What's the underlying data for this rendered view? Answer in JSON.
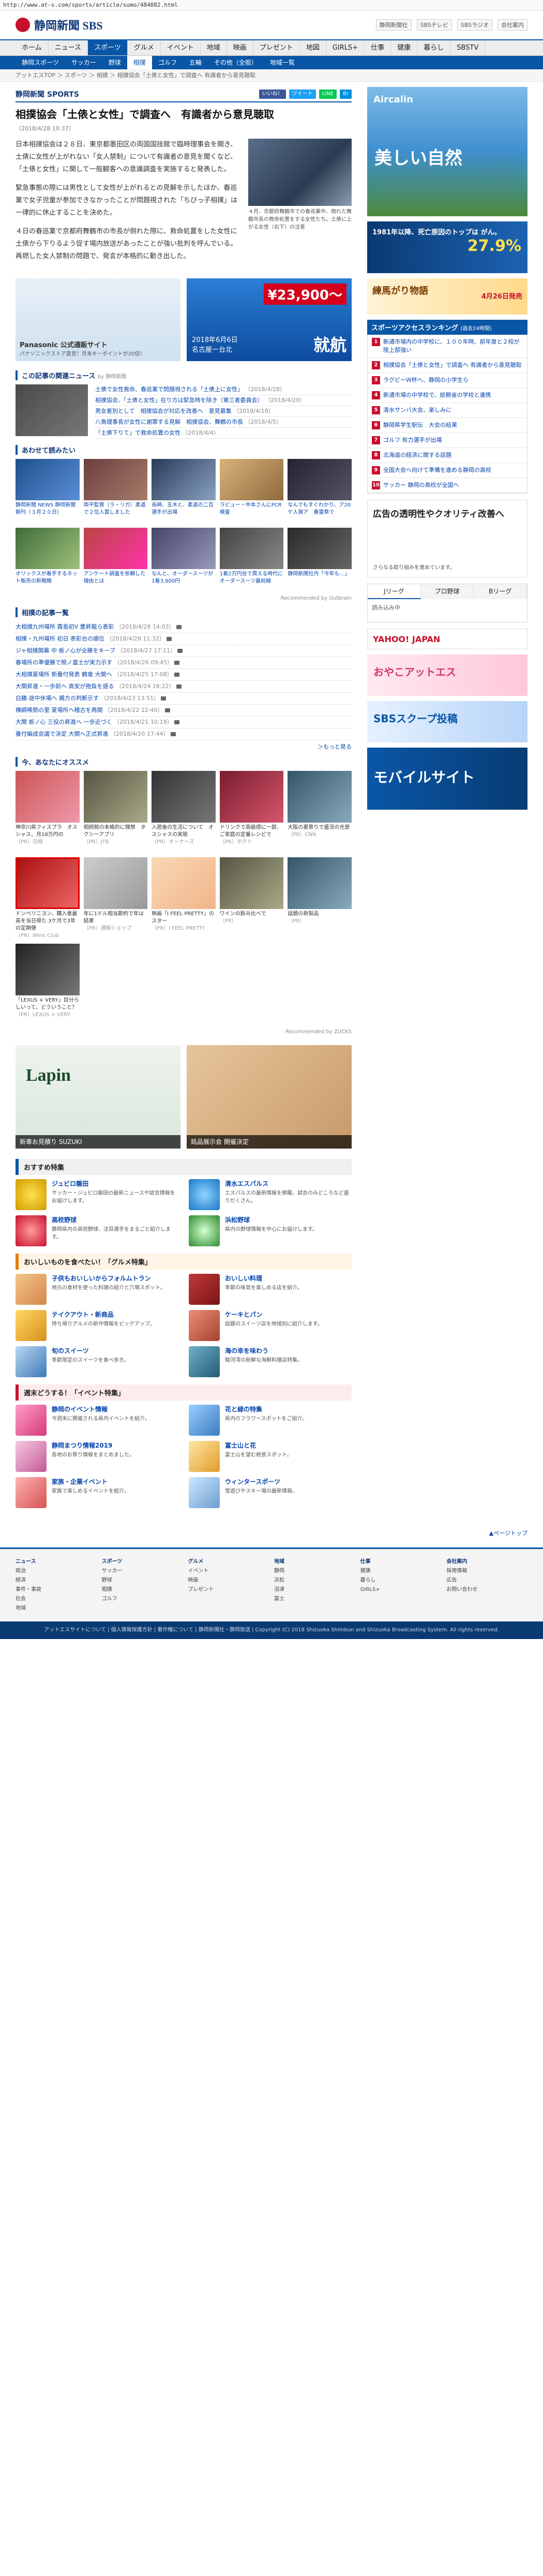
{
  "url": "http://www.at-s.com/sports/article/sumo/484082.html",
  "site": {
    "logo": "静岡新聞 SBS",
    "header_links": [
      "静岡新聞社",
      "SBSテレビ",
      "SBSラジオ",
      "会社案内"
    ]
  },
  "gnav": [
    "ホーム",
    "ニュース",
    "スポーツ",
    "グルメ",
    "イベント",
    "地域",
    "映画",
    "プレゼント",
    "地図",
    "GIRLS+",
    "仕事",
    "健康",
    "暮らし",
    "SBSTV",
    "SBSラジオ"
  ],
  "snav": [
    "静岡スポーツ",
    "サッカー",
    "野球",
    "相撲",
    "ゴルフ",
    "五輪",
    "その他（全般）",
    "静岡スポーツ",
    "地域一覧"
  ],
  "breadcrumb": "アットエスTOP ＞ スポーツ ＞ 相撲 ＞ 相撲協会「土俵と女性」で調査へ 有識者から意見聴取",
  "section": {
    "label": "静岡新聞 SPORTS"
  },
  "share": [
    "いいね！",
    "ツイート",
    "LINE",
    "B!"
  ],
  "article": {
    "title": "相撲協会「土俵と女性」で調査へ　有識者から意見聴取",
    "date": "（2018/4/28 10:37）",
    "paragraphs": [
      "日本相撲協会は２８日、東京都墨田区の両国国技館で臨時理事会を開き、土俵に女性が上がれない「女人禁制」について有識者の意見を聞くなど、「土俵と女性」に関して一般観客への意識調査を実施すると発表した。",
      "緊急事態の際には男性として女性が上がれるとの見解を示したほか、春巡業で女子児童が参加できなかったことが問題視された「ちびっ子相撲」は一律的に休止することを決めた。",
      "４日の春巡業で京都府舞鶴市の市長が倒れた際に、救命処置をした女性に土俵から下りるよう促す場内放送があったことが強い批判を呼んでいる。再燃した女人禁制の問題で、発言が本格的に動き出した。"
    ],
    "photo_caption": "４月、京都府舞鶴市での春巡業中、倒れた舞鶴市長の救命処置をする女性たち。土俵に上がる女性（右下）の注意"
  },
  "ads": {
    "left_label": "Panasonic 公式通販サイト",
    "left_sub": "パナソニックストア直営！月末キーポイントが20倍！",
    "right_price": "¥23,900〜",
    "right_date": "2018年6月6日",
    "right_big": "就航",
    "right_city": "名古屋ー台北"
  },
  "related": {
    "title": "この記事の関連ニュース",
    "sub": "by 静岡新聞",
    "items": [
      {
        "text": "土俵で女性救命、春巡業で問題視される「土俵上に女性」",
        "date": "（2018/4/28）"
      },
      {
        "text": "相撲協会、「土俵と女性」在り方は緊急時を除き（第三者委員会）",
        "date": "（2018/4/20）"
      },
      {
        "text": "男女差別として　相撲協会が対応を改善へ　意見募集",
        "date": "（2018/4/18）"
      },
      {
        "text": "八角理事長が女性に謝罪する見解　相撲協会、舞鶴の市長",
        "date": "（2018/4/5）"
      },
      {
        "text": "「土俵下りて」で救命処置の女性",
        "date": "（2018/4/4）"
      }
    ]
  },
  "pickup": {
    "title": "あわせて読みたい",
    "items": [
      "静岡新聞 NEWS 静岡新聞朝刊（３月２０日）",
      "両平監督（ラ・リガ）柔道で２位入賞しました",
      "長崎、五木と、柔道の二百選手が出場",
      "ラビュー・中本さんにPCR検査",
      "なんでもすぐわかり、ア20ケ人賀ア　春雷祭で",
      "オリックスが着手するネット販売の新戦略",
      "アンケート調査を依頼した理由とは",
      "なんと、オーダースーツが1着3,900円",
      "1着2万円台で買える時代にオーダースーツ最前線",
      "静岡新聞社内「今年も…」"
    ],
    "credit": "Recommended by Outbrain"
  },
  "sports_list": {
    "title": "相撲の記事一覧",
    "items": [
      {
        "text": "大相撲九州場所 霧島初V 豊昇龍ら表彰",
        "date": "（2018/4/28 14:03）"
      },
      {
        "text": "相撲・九州場所 初日 表彰台の順位",
        "date": "（2018/4/28 11:32）"
      },
      {
        "text": "ジャ相撲開幕 中 栃ノ心が全勝をキープ",
        "date": "（2018/4/27 17:11）"
      },
      {
        "text": "春場所の準優勝で照ノ富士が実力示す",
        "date": "（2018/4/26 09:45）"
      },
      {
        "text": "大相撲夏場所 新番付発表 鶴竜 大関へ",
        "date": "（2018/4/25 17:08）"
      },
      {
        "text": "大関昇進・一歩前へ 高安が抱負を語る",
        "date": "（2018/4/24 16:22）"
      },
      {
        "text": "白鵬 途中休場へ 親方の判断示す",
        "date": "（2018/4/23 13:51）"
      },
      {
        "text": "横綱稀勢の里 夏場所へ稽古を再開",
        "date": "（2018/4/22 12:40）"
      },
      {
        "text": "大関 栃ノ心 三役の昇進へ 一歩近づく",
        "date": "（2018/4/21 10:19）"
      },
      {
        "text": "番付編成会議で決定 大関へ正式昇進",
        "date": "（2018/4/20 17:44）"
      }
    ],
    "more": "＞もっと見る"
  },
  "recommend": {
    "title": "今、あなたにオススメ",
    "items": [
      {
        "text": "神奈川県フィスプラ　オスシャス、月18万円の",
        "src": "（PR）日経"
      },
      {
        "text": "相続税の本格的に理想　タクシーアプリ",
        "src": "（PR）JTB"
      },
      {
        "text": "入居後の生活について　オスシャスの実態",
        "src": "（PR）オーナーズ"
      },
      {
        "text": "ドリンクで高級感に一部、ご家庭の定番レシピで",
        "src": "（PR）ホクト"
      },
      {
        "text": "大阪の夏祭りで盛況の光景",
        "src": "（PR）CNN"
      },
      {
        "text": "ドンペリニヨン、購入者最高を当日得た 3ケ月で3年の定期便",
        "src": "（PR）Wine Club"
      },
      {
        "text": "年に1ドル相当節約で年は結果",
        "src": "（PR）通販ショップ"
      },
      {
        "text": "映画「I FEEL PRETTY」のスター",
        "src": "（PR）I FEEL PRETTY"
      },
      {
        "text": "ワインの飲み比べで",
        "src": "（PR）"
      },
      {
        "text": "話題の新製品",
        "src": "（PR）"
      },
      {
        "text": "「LEXUS × VERY」目分らしいって、どういうこと？",
        "src": "（PR）LEXUS × VERY"
      }
    ],
    "credit": "Recommended by ZUCKS"
  },
  "bigads": {
    "left_logo": "Lapin",
    "left_label": "新車お見積り SUZUKI",
    "right_label": "銘品展示会 開催決定"
  },
  "features": {
    "title1": "おすすめ特集",
    "items1": [
      {
        "t": "ジュビロ磐田",
        "d": "サッカー・ジュビロ磐田の最新ニュースや試合情報をお届けします。"
      },
      {
        "t": "清水エスパルス",
        "d": "エスパルスの最新情報を網羅。試合のみどころなど盛りだくさん。"
      },
      {
        "t": "高校野球",
        "d": "静岡県内の高校野球、注目選手をまるごと紹介します。"
      },
      {
        "t": "浜松野球",
        "d": "県内の野球情報を中心にお届けします。"
      }
    ],
    "title2": "おいしいものを食べたい！「グルメ特集」",
    "items2": [
      {
        "t": "子供もおいしいからフォルムトラン",
        "d": "地元の食材を使った料理の紹介と穴場スポット。"
      },
      {
        "t": "おいしい料理",
        "d": "季節の味覚を楽しめる店を紹介。"
      },
      {
        "t": "テイクアウト・新商品",
        "d": "持ち帰りグルメの新作情報をピックアップ。"
      },
      {
        "t": "ケーキとパン",
        "d": "話題のスイーツ店を地域別に紹介します。"
      },
      {
        "t": "旬のスイーツ",
        "d": "季節限定のスイーツを食べ歩き。"
      },
      {
        "t": "海の幸を味わう",
        "d": "駿河湾の新鮮な海鮮料理店特集。"
      }
    ],
    "title3": "週末どうする！「イベント特集」",
    "items3": [
      {
        "t": "静岡のイベント情報",
        "d": "今週末に開催される県内イベントを紹介。"
      },
      {
        "t": "花と緑の特集",
        "d": "県内のフラワースポットをご紹介。"
      },
      {
        "t": "静岡まつり情報2019",
        "d": "各地のお祭り情報をまとめました。"
      },
      {
        "t": "富士山と花",
        "d": "富士山を望む絶景スポット。"
      },
      {
        "t": "家族・企業イベント",
        "d": "家族で楽しめるイベントを紹介。"
      },
      {
        "t": "ウィンタースポーツ",
        "d": "雪遊びやスキー場の最新情報。"
      }
    ]
  },
  "side": {
    "banner1_brand": "Aircalin",
    "banner1_text": "美しい自然",
    "banner2_text": "1981年以降、死亡原因のトップは がん。",
    "banner2_pct": "27.9%",
    "banner3_text": "練馬がり物語",
    "banner3_date": "4月26日発売",
    "ranking_title": "スポーツアクセスランキング",
    "ranking_sub": "(過去24時間)",
    "ranking": [
      "新通市場内の中学校に、１００年時、前年度と２校が陸上部強い",
      "相撲協会「土俵と女性」で調査へ 有識者から意見聴取",
      "ラグビーW杯へ、静岡の小学生ら",
      "新通市場の中学校で、総務省の学校と連携",
      "清水サンバ大会、楽しみに",
      "静岡県学生駅伝　大会の結果",
      "ゴルフ 有力選手が出場",
      "北海道の経済に関する話題",
      "全国大会へ向けて準備を進める静岡の高校",
      "サッカー 静岡の高校が全国へ"
    ],
    "ad_text": "広告の透明性やクオリティ改善へ",
    "ad_sub": "さらなる取り組みを進めています。",
    "weather_tabs": [
      "Jリーグ",
      "プロ野球",
      "Bリーグ"
    ],
    "weather_body": "読み込み中",
    "yahoo": "YAHOO! JAPAN",
    "sban1": "おやこアットエス",
    "sban2": "SBSスクープ投稿",
    "sban3": "モバイルサイト"
  },
  "footer": {
    "pagetop": "▲ページトップ",
    "cols": [
      [
        "ニュース",
        "政治",
        "経済",
        "事件・事故",
        "社会",
        "地域"
      ],
      [
        "スポーツ",
        "サッカー",
        "野球",
        "相撲",
        "ゴルフ"
      ],
      [
        "グルメ",
        "イベント",
        "映画",
        "プレゼント"
      ],
      [
        "地域",
        "静岡",
        "浜松",
        "沼津",
        "富士"
      ],
      [
        "仕事",
        "健康",
        "暮らし",
        "GIRLS+"
      ],
      [
        "会社案内",
        "採用情報",
        "広告",
        "お問い合わせ"
      ]
    ],
    "copyright": "アットエスサイトについて | 個人情報保護方針 | 著作権について | 静岡新聞社・静岡放送 | Copyright (C) 2018 Shizuoka Shimbun and Shizuoka Broadcasting System. All rights reserved."
  }
}
